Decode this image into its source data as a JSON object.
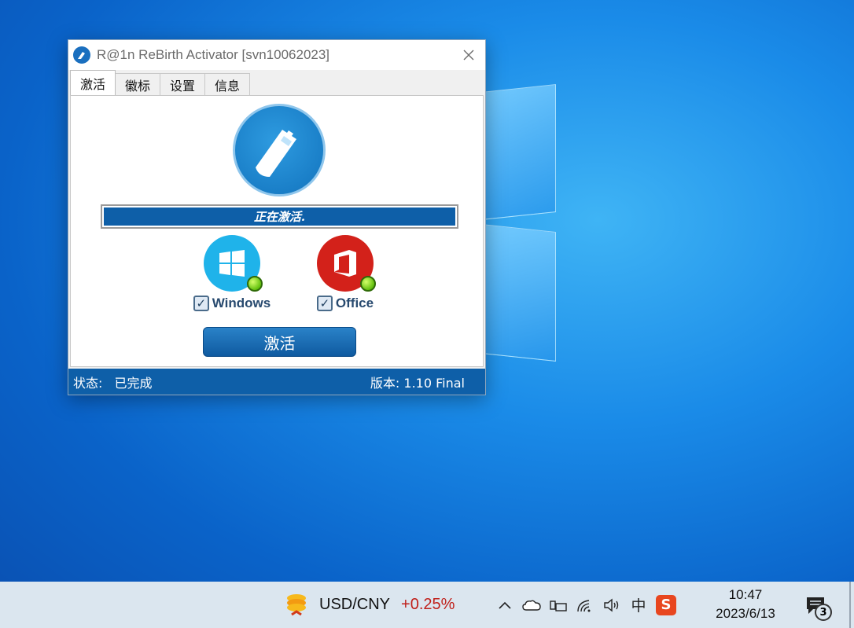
{
  "window": {
    "title": "R@1n ReBirth Activator [svn10062023]",
    "close_icon": "close-icon"
  },
  "tabs": [
    {
      "label": "激活",
      "active": true
    },
    {
      "label": "徽标",
      "active": false
    },
    {
      "label": "设置",
      "active": false
    },
    {
      "label": "信息",
      "active": false
    }
  ],
  "progress": {
    "text": "正在激活.",
    "fraction": 1.0
  },
  "products": [
    {
      "label": "Windows",
      "checked": true,
      "color": "#1fb3ea"
    },
    {
      "label": "Office",
      "checked": true,
      "color": "#d3211a"
    }
  ],
  "activate_label": "激活",
  "status": {
    "prefix": "状态:",
    "value": "已完成",
    "version": "版本: 1.10 Final"
  },
  "taskbar": {
    "ticker_pair": "USD/CNY",
    "ticker_change": "+0.25%",
    "tray_chevron": "^",
    "ime": "中",
    "sogou": "S",
    "time": "10:47",
    "date": "2023/6/13",
    "notification_count": "3"
  },
  "colors": {
    "accent": "#0e5fa8",
    "change_negative": "#c0201a"
  }
}
